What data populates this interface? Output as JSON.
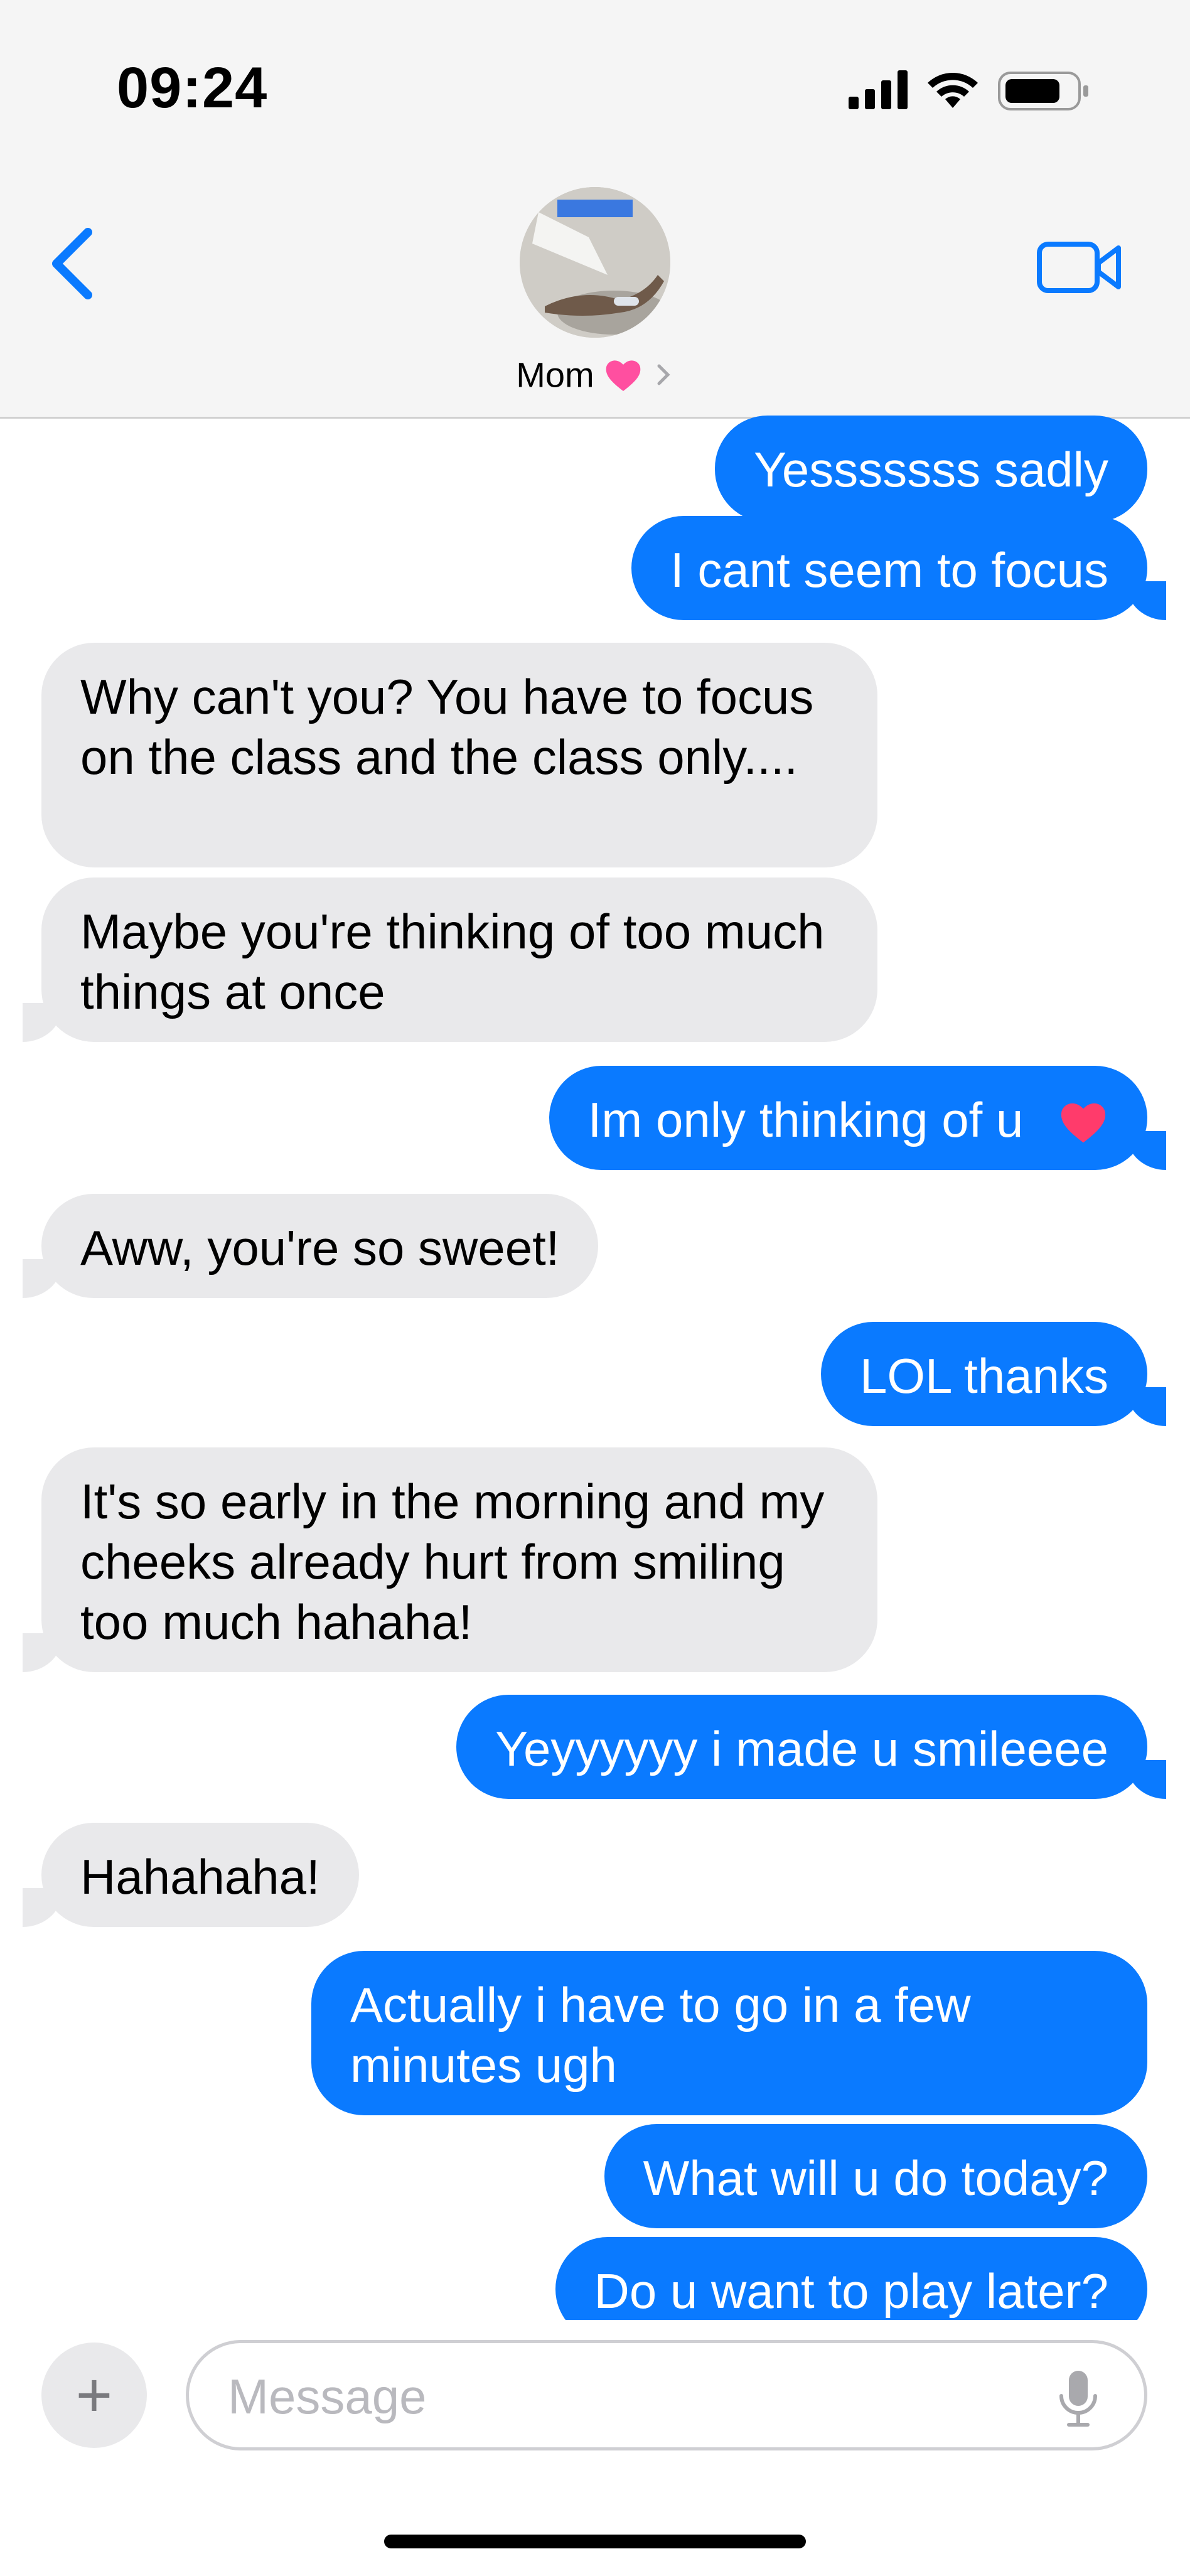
{
  "status_bar": {
    "time": "09:24"
  },
  "header": {
    "contact_name": "Mom"
  },
  "messages": [
    {
      "from": "me",
      "text": "Yesssssss sadly"
    },
    {
      "from": "me",
      "text": "I cant seem to focus"
    },
    {
      "from": "them",
      "text": "Why can't you? You have to focus on the class and the class only...."
    },
    {
      "from": "them",
      "text": "Maybe you're thinking of too much things at once"
    },
    {
      "from": "me",
      "text": "Im only thinking of u"
    },
    {
      "from": "them",
      "text": "Aww, you're so sweet!"
    },
    {
      "from": "me",
      "text": "LOL thanks"
    },
    {
      "from": "them",
      "text": "It's so early in the morning and my cheeks already hurt from smiling too much hahaha!"
    },
    {
      "from": "me",
      "text": "Yeyyyyyy i made u smileeee"
    },
    {
      "from": "them",
      "text": "Hahahaha!"
    },
    {
      "from": "me",
      "text": "Actually i have to go in a few minutes ugh"
    },
    {
      "from": "me",
      "text": "What will u do today?"
    },
    {
      "from": "me",
      "text": "Do u want to play later?"
    }
  ],
  "composer": {
    "placeholder": "Message"
  },
  "colors": {
    "accent": "#0a7aff",
    "incoming_bubble": "#e9e9eb",
    "heart": "#ff4fa0"
  },
  "icons": [
    "back-chevron-icon",
    "video-camera-icon",
    "heart-emoji-icon",
    "chevron-right-icon",
    "plus-icon",
    "microphone-icon",
    "signal-icon",
    "wifi-icon",
    "battery-icon"
  ]
}
